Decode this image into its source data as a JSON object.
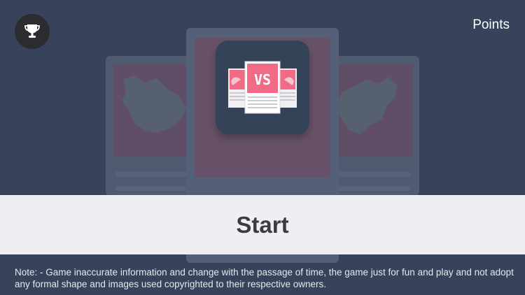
{
  "header": {
    "trophy_icon": "trophy-icon",
    "points_label": "Points"
  },
  "logo": {
    "vs_text": "VS",
    "icon": "vs-cards-icon"
  },
  "start": {
    "label": "Start"
  },
  "footer": {
    "note": "Note: - Game inaccurate information and change with the passage of time, the game just for fun and play and not adopt any formal shape and images used copyrighted to their respective owners."
  },
  "colors": {
    "background": "#36435a",
    "accent_pink": "#f26b86",
    "start_bar": "#efeef2"
  }
}
